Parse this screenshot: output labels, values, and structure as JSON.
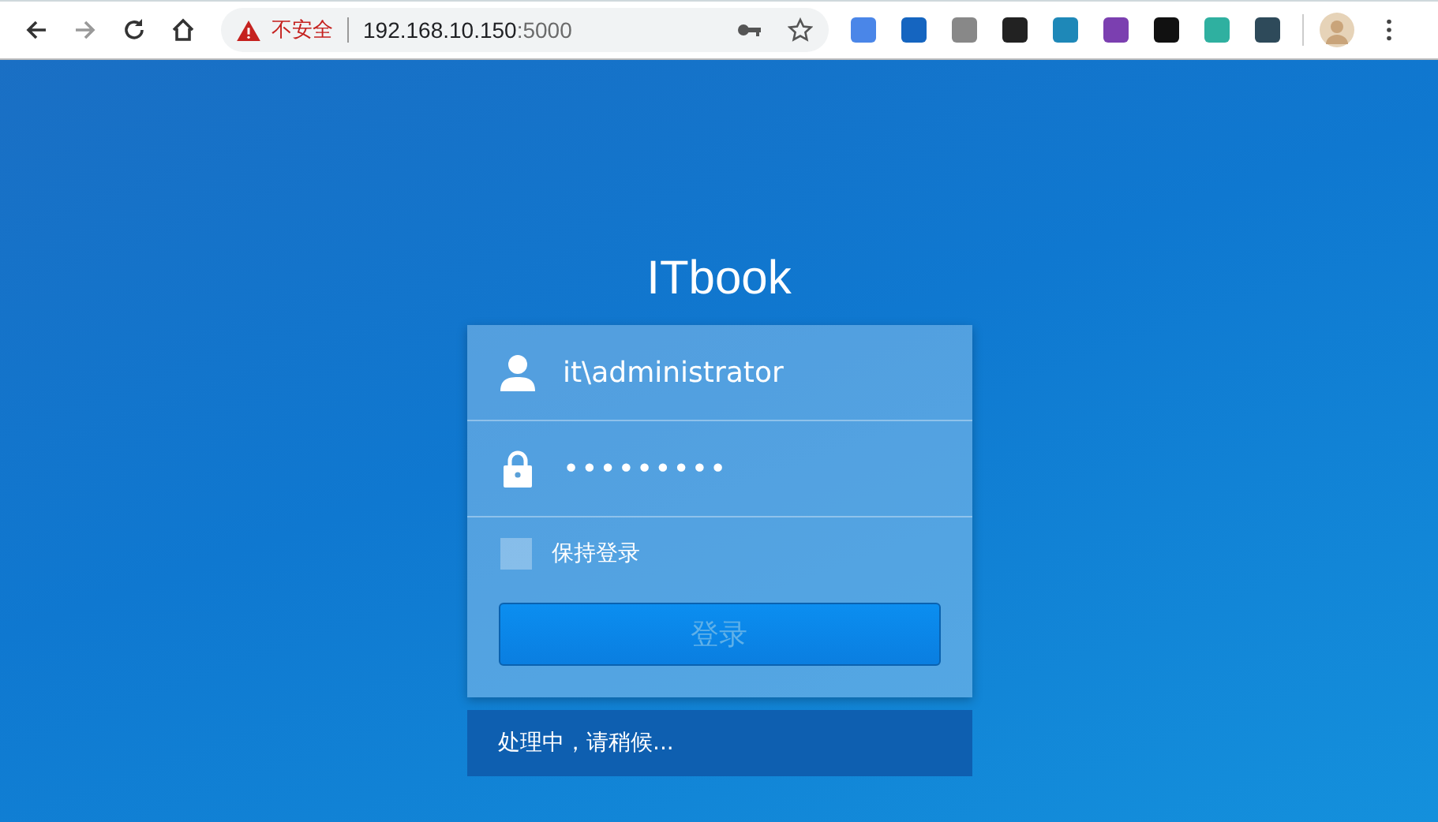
{
  "browser": {
    "security_label": "不安全",
    "url_host": "192.168.10.150",
    "url_port": ":5000",
    "extensions": [
      {
        "color": "#4a86e8"
      },
      {
        "color": "#1565c0"
      },
      {
        "color": "#888888"
      },
      {
        "color": "#222222"
      },
      {
        "color": "#1e88b8"
      },
      {
        "color": "#7b3fb0"
      },
      {
        "color": "#111111"
      },
      {
        "color": "#2fb0a0"
      },
      {
        "color": "#2e4a5a"
      }
    ]
  },
  "login": {
    "title": "ITbook",
    "username": "it\\administrator",
    "password": "•••••••••",
    "remember": {
      "label": "保持登录",
      "checked": false
    },
    "submit": {
      "label": "登录",
      "disabled": true
    },
    "status": "处理中，请稍候..."
  }
}
